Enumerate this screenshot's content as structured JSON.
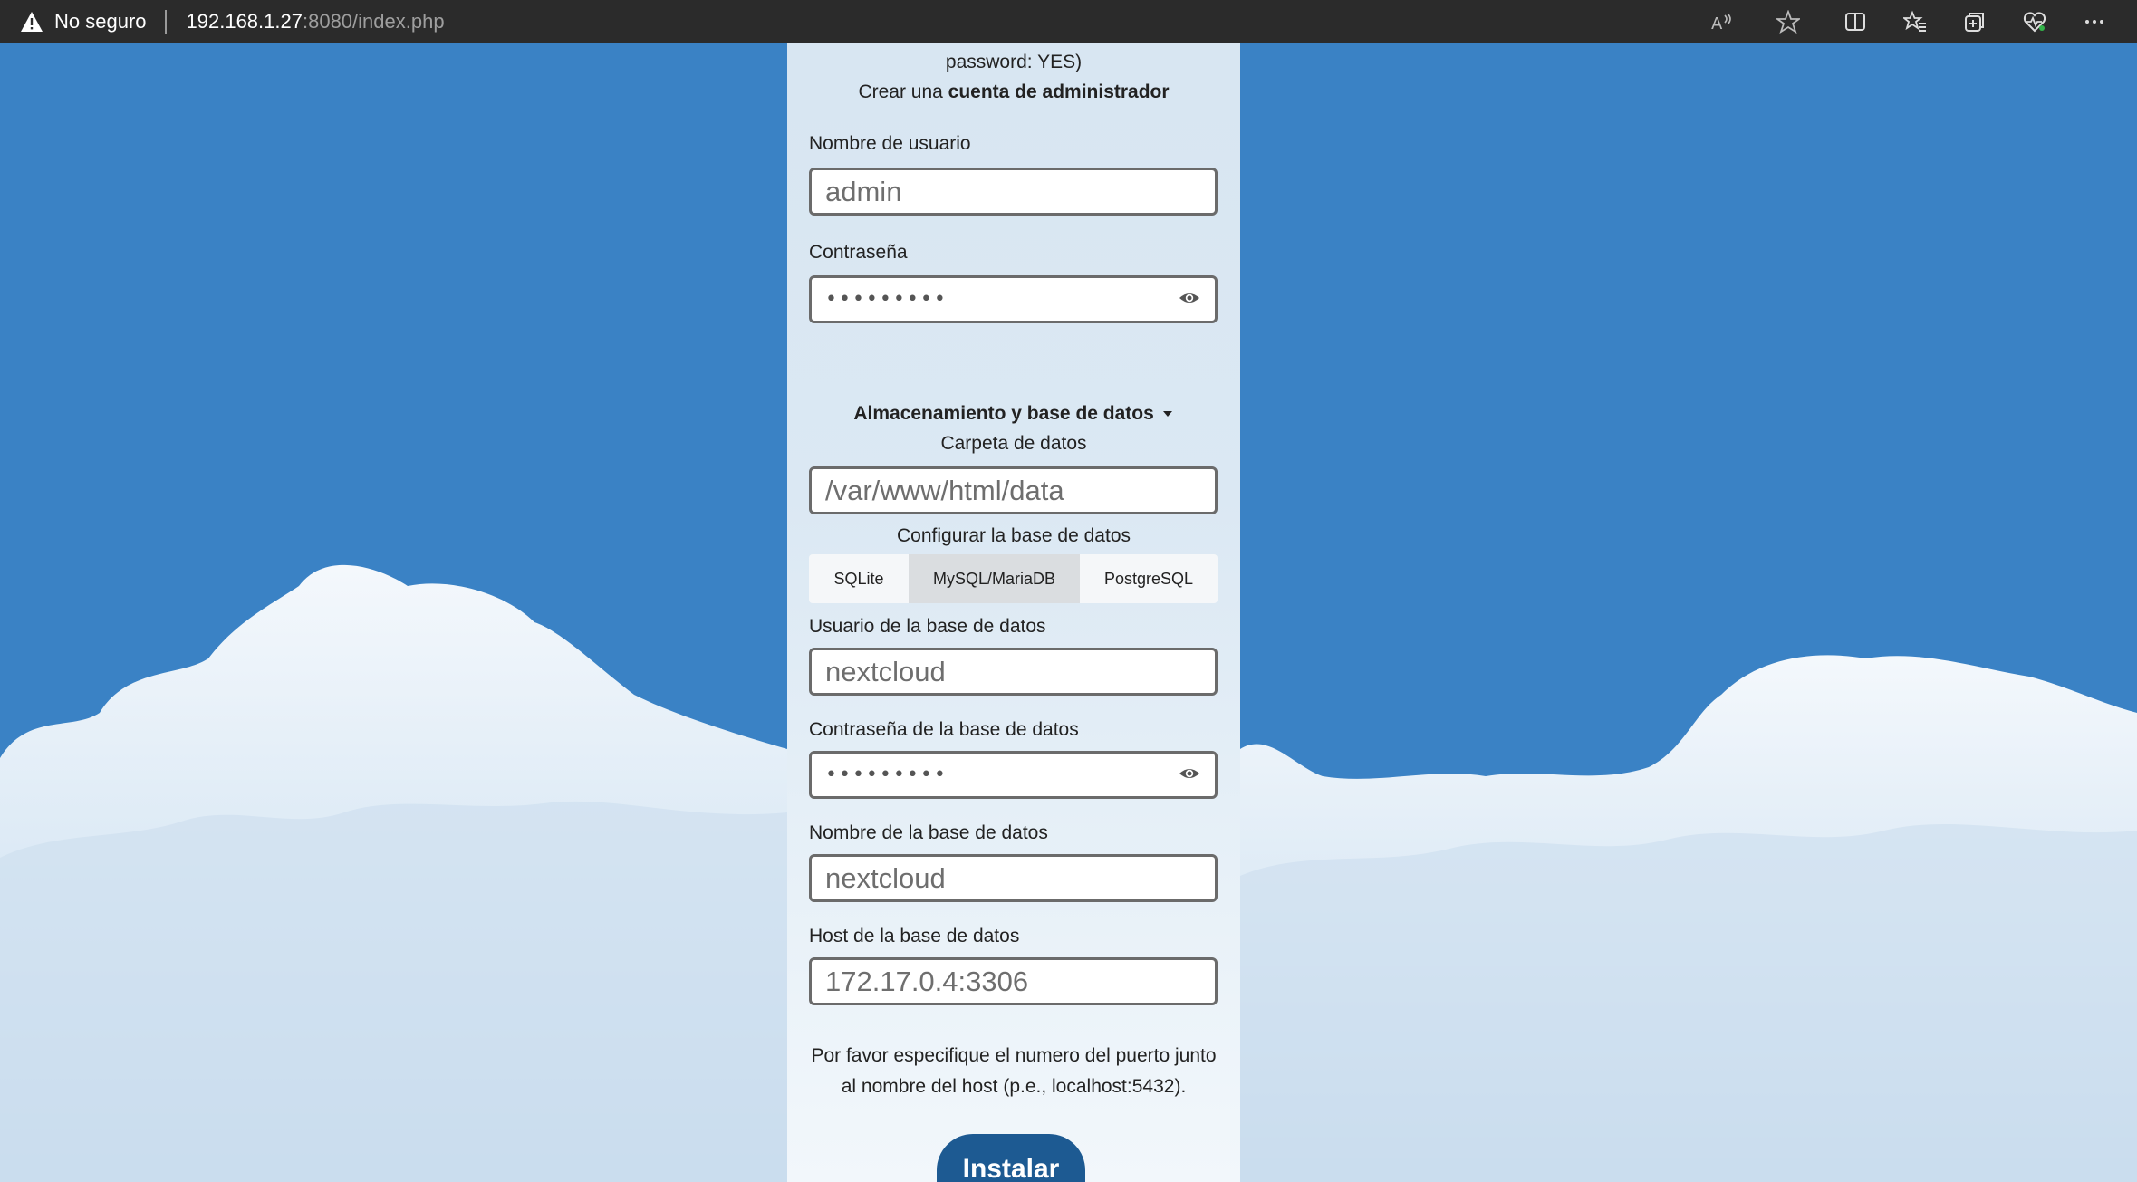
{
  "browser": {
    "security_label": "No seguro",
    "url_host": "192.168.1.27",
    "url_rest": ":8080/index.php",
    "toolbar_icons": [
      "read-aloud-icon",
      "favorite-star-icon",
      "split-screen-icon",
      "favorites-icon",
      "collections-icon",
      "browser-essentials-icon",
      "more-icon"
    ]
  },
  "setup": {
    "partial_line": "password: YES)",
    "admin_prefix": "Crear una ",
    "admin_bold": "cuenta de administrador",
    "username_label": "Nombre de usuario",
    "username_value": "admin",
    "password_label": "Contraseña",
    "password_mask": "•••••••••",
    "storage_toggle": "Almacenamiento y base de datos",
    "data_folder_label": "Carpeta de datos",
    "data_folder_value": "/var/www/html/data",
    "configure_db_label": "Configurar la base de datos",
    "db_types": [
      "SQLite",
      "MySQL/MariaDB",
      "PostgreSQL"
    ],
    "db_type_selected": "MySQL/MariaDB",
    "db_user_label": "Usuario de la base de datos",
    "db_user_value": "nextcloud",
    "db_password_label": "Contraseña de la base de datos",
    "db_password_mask": "•••••••••",
    "db_name_label": "Nombre de la base de datos",
    "db_name_value": "nextcloud",
    "db_host_label": "Host de la base de datos",
    "db_host_value": "172.17.0.4:3306",
    "hint_line1": "Por favor especifique el numero del puerto junto",
    "hint_line2": "al nombre del host (p.e., localhost:5432).",
    "install_label": "Instalar"
  },
  "colors": {
    "sky": "#3a82c5",
    "install_button": "#1d5a92",
    "topbar": "#2b2b2b"
  }
}
